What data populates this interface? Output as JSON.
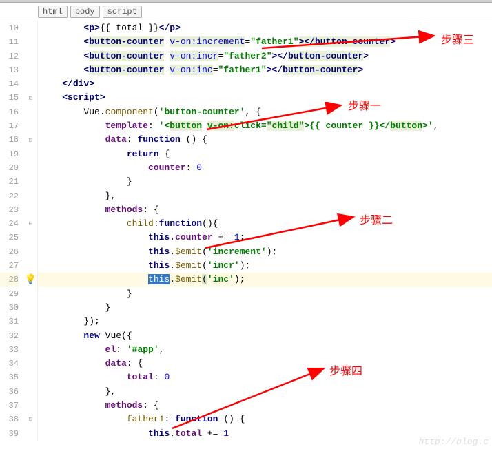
{
  "breadcrumb": {
    "items": [
      "html",
      "body",
      "script"
    ]
  },
  "lineStart": 10,
  "lineEnd": 39,
  "annotations": {
    "step1": "步骤一",
    "step2": "步骤二",
    "step3": "步骤三",
    "step4": "步骤四"
  },
  "code": {
    "l10": {
      "indent": "        ",
      "open": "<",
      "tag": "p",
      "close": ">",
      "text": "{{ total }}",
      "open2": "</",
      "tag2": "p",
      "close2": ">"
    },
    "l11": {
      "indent": "        ",
      "open": "<",
      "tag": "button-counter",
      "sp": " ",
      "attr": "v-on:increment",
      "eq": "=",
      "val": "\"father1\"",
      "close": ">",
      "open2": "</",
      "tag2": "button-counter",
      "close2": ">"
    },
    "l12": {
      "indent": "        ",
      "open": "<",
      "tag": "button-counter",
      "sp": " ",
      "attr": "v-on:incr",
      "eq": "=",
      "val": "\"father2\"",
      "close": ">",
      "open2": "</",
      "tag2": "button-counter",
      "close2": ">"
    },
    "l13": {
      "indent": "        ",
      "open": "<",
      "tag": "button-counter",
      "sp": " ",
      "attr": "v-on:inc",
      "eq": "=",
      "val": "\"father1\"",
      "close": ">",
      "open2": "</",
      "tag2": "button-counter",
      "close2": ">"
    },
    "l14": {
      "indent": "    ",
      "open": "</",
      "tag": "div",
      "close": ">"
    },
    "l15": {
      "indent": "    ",
      "open": "<",
      "tag": "script",
      "close": ">"
    },
    "l16": {
      "indent": "        ",
      "obj": "Vue",
      "dot": ".",
      "method": "component",
      "paren": "(",
      "str": "'button-counter'",
      "comma": ", {"
    },
    "l17": {
      "indent": "            ",
      "prop": "template",
      "colon": ": ",
      "str1": "'<",
      "tag": "button",
      "sp": " ",
      "attr": "v-on:",
      "attr2": "click",
      "eq": "=",
      "val": "\"child\"",
      "close": ">",
      "txt": "{{ counter }}",
      "open2": "</",
      "tag2": "button",
      "close2": ">'",
      "comma": ","
    },
    "l18": {
      "indent": "            ",
      "prop": "data",
      "colon": ": ",
      "kw": "function",
      "rest": " () {"
    },
    "l19": {
      "indent": "                ",
      "kw": "return",
      "rest": " {"
    },
    "l20": {
      "indent": "                    ",
      "prop": "counter",
      "colon": ": ",
      "num": "0"
    },
    "l21": {
      "indent": "                ",
      "rest": "}"
    },
    "l22": {
      "indent": "            ",
      "rest": "},"
    },
    "l23": {
      "indent": "            ",
      "prop": "methods",
      "colon": ": {"
    },
    "l24": {
      "indent": "                ",
      "fn": "child",
      "colon": ":",
      "kw": "function",
      "rest": "(){"
    },
    "l25": {
      "indent": "                    ",
      "kw": "this",
      "dot": ".",
      "prop": "counter",
      "rest": " += ",
      "num": "1",
      "semi": ";"
    },
    "l26": {
      "indent": "                    ",
      "kw": "this",
      "dot": ".",
      "method": "$emit",
      "paren": "(",
      "str": "'increment'",
      "rest": ");"
    },
    "l27": {
      "indent": "                    ",
      "kw": "this",
      "dot": ".",
      "method": "$emit",
      "paren": "(",
      "str": "'incr'",
      "rest": ");"
    },
    "l28": {
      "indent": "                    ",
      "kw": "this",
      "dot": ".",
      "method": "$emit",
      "paren": "(",
      "str": "'inc'",
      "rest": ");"
    },
    "l29": {
      "indent": "                ",
      "rest": "}"
    },
    "l30": {
      "indent": "            ",
      "rest": "}"
    },
    "l31": {
      "indent": "        ",
      "rest": "});"
    },
    "l32": {
      "indent": "        ",
      "kw": "new",
      "sp": " ",
      "obj": "Vue",
      "rest": "({"
    },
    "l33": {
      "indent": "            ",
      "prop": "el",
      "colon": ": ",
      "str": "'#app'",
      "comma": ","
    },
    "l34": {
      "indent": "            ",
      "prop": "data",
      "colon": ": {"
    },
    "l35": {
      "indent": "                ",
      "prop": "total",
      "colon": ": ",
      "num": "0"
    },
    "l36": {
      "indent": "            ",
      "rest": "},"
    },
    "l37": {
      "indent": "            ",
      "prop": "methods",
      "colon": ": {"
    },
    "l38": {
      "indent": "                ",
      "fn": "father1",
      "colon": ": ",
      "kw": "function",
      "rest": " () {"
    },
    "l39": {
      "indent": "                    ",
      "kw": "this",
      "dot": ".",
      "prop": "total",
      "rest": " += ",
      "num": "1"
    }
  },
  "watermark": "http://blog.c"
}
